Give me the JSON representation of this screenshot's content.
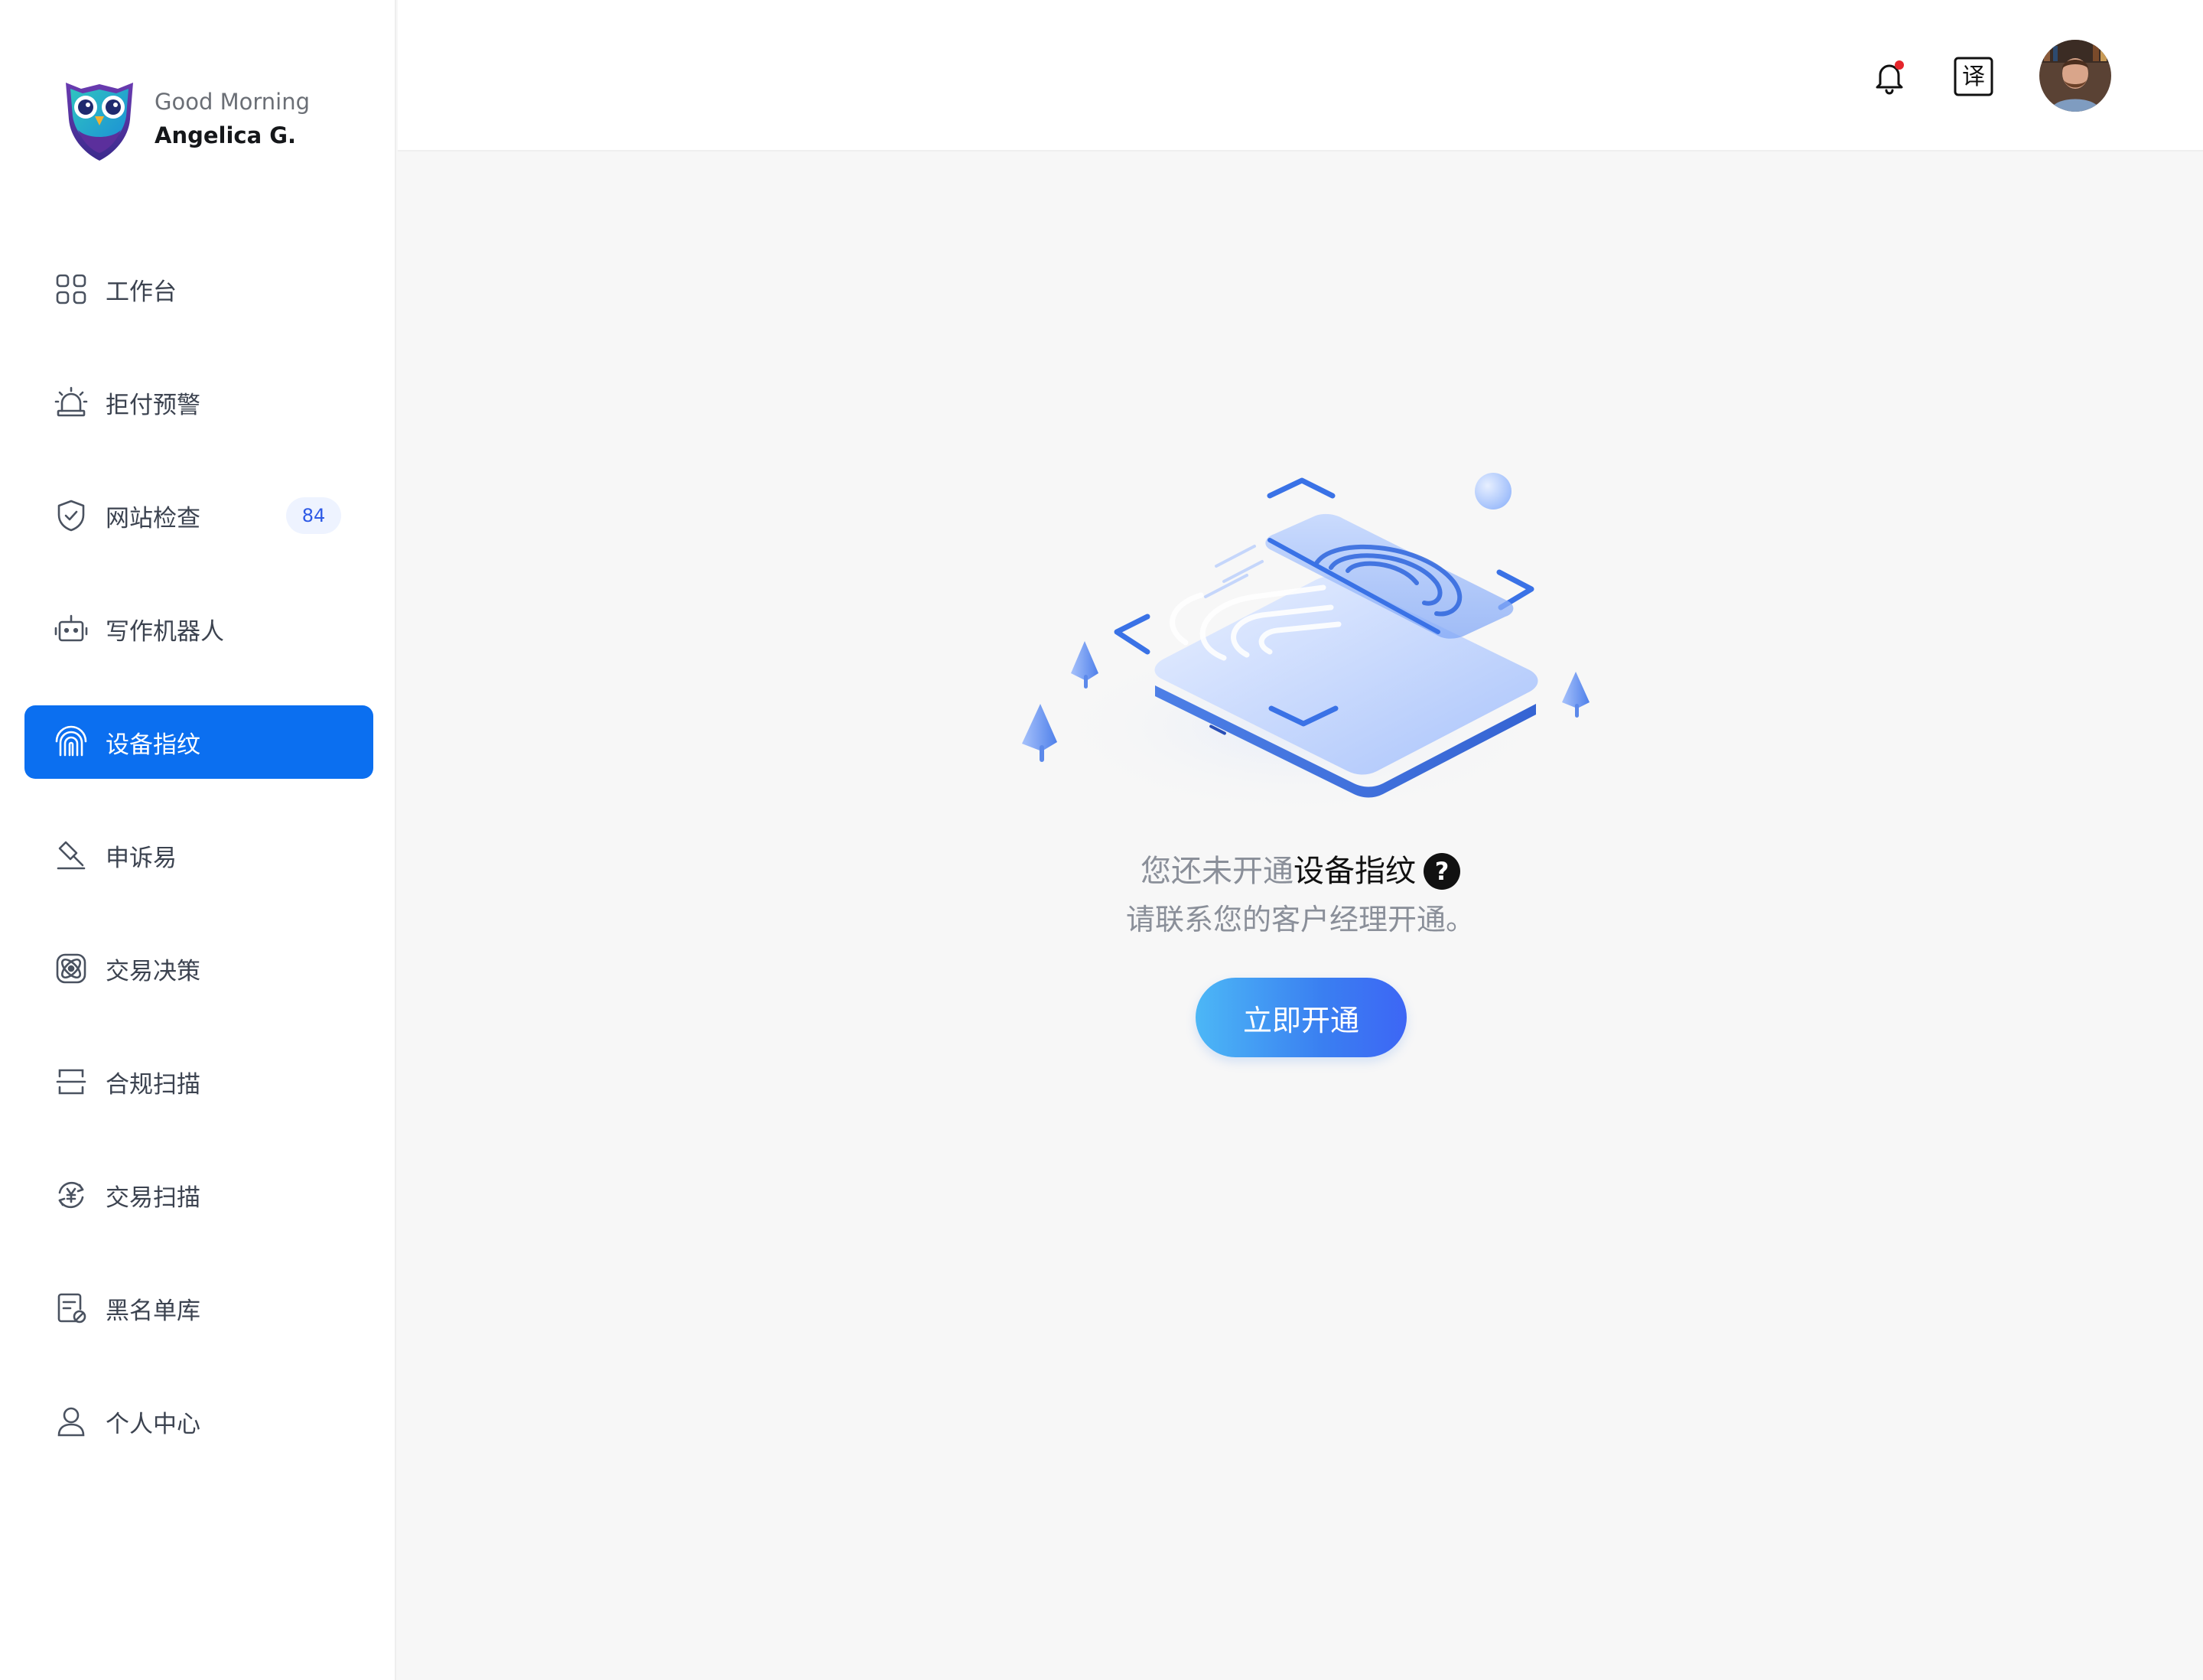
{
  "brand": {
    "greeting": "Good Morning",
    "user_name": "Angelica G."
  },
  "sidebar": {
    "items": [
      {
        "label": "工作台",
        "icon": "grid-icon"
      },
      {
        "label": "拒付预警",
        "icon": "alarm-icon"
      },
      {
        "label": "网站检查",
        "icon": "shield-check-icon",
        "badge": "84"
      },
      {
        "label": "写作机器人",
        "icon": "robot-icon"
      },
      {
        "label": "设备指纹",
        "icon": "fingerprint-icon",
        "active": true
      },
      {
        "label": "申诉易",
        "icon": "gavel-icon"
      },
      {
        "label": "交易决策",
        "icon": "atom-icon"
      },
      {
        "label": "合规扫描",
        "icon": "scan-icon"
      },
      {
        "label": "交易扫描",
        "icon": "yen-refresh-icon"
      },
      {
        "label": "黑名单库",
        "icon": "blocklist-icon"
      },
      {
        "label": "个人中心",
        "icon": "user-icon"
      }
    ]
  },
  "topbar": {
    "translate_glyph": "译"
  },
  "main": {
    "message_prefix": "您还未开通",
    "message_feature": "设备指纹",
    "help_glyph": "?",
    "message_line2": "请联系您的客户经理开通。",
    "open_button": "立即开通"
  },
  "colors": {
    "primary": "#0b6ff0",
    "badge_bg": "#eef3ff",
    "badge_text": "#2e5ae6",
    "notification_dot": "#e5252b",
    "button_gradient_start": "#4cb7f6",
    "button_gradient_end": "#3d66f5"
  }
}
